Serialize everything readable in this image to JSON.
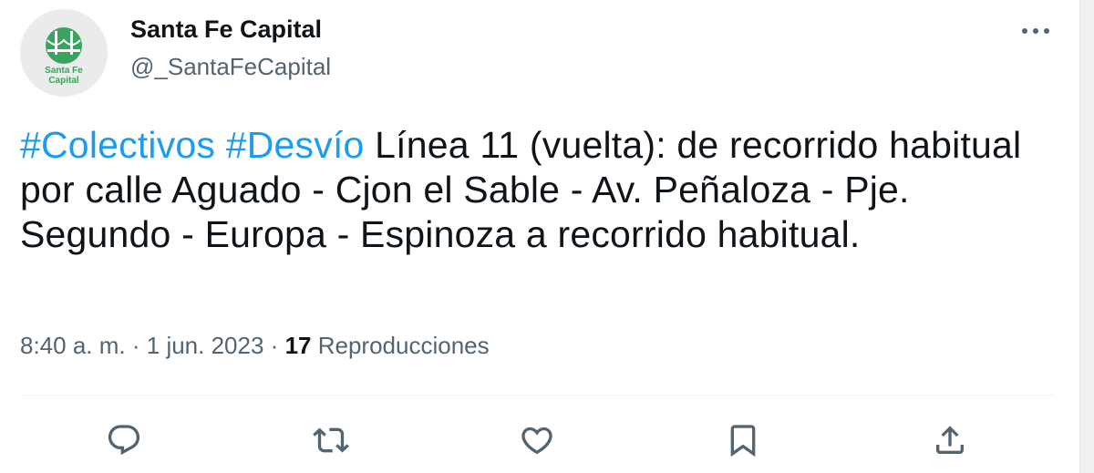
{
  "account": {
    "display_name": "Santa Fe Capital",
    "handle": "@_SantaFeCapital",
    "avatar_text_line1": "Santa Fe",
    "avatar_text_line2": "Capital",
    "avatar_icon": "bridge-logo-icon"
  },
  "tweet": {
    "hashtag1": "#Colectivos",
    "hashtag2": "#Desvío",
    "body": "Línea 11 (vuelta): de recorrido habitual por calle Aguado - Cjon el Sable - Av. Peñaloza - Pje. Segundo - Europa - Espinoza a recorrido habitual."
  },
  "meta": {
    "time": "8:40 a. m.",
    "separator": "·",
    "date": "1 jun. 2023",
    "views_count": "17",
    "views_label": "Reproducciones"
  },
  "actions": [
    {
      "name": "reply",
      "icon": "reply-icon"
    },
    {
      "name": "retweet",
      "icon": "retweet-icon"
    },
    {
      "name": "like",
      "icon": "heart-icon"
    },
    {
      "name": "bookmark",
      "icon": "bookmark-icon"
    },
    {
      "name": "share",
      "icon": "share-icon"
    }
  ],
  "colors": {
    "link": "#1d9bf0",
    "text": "#0f1419",
    "secondary": "#536471",
    "brand_green": "#3aa35f"
  }
}
